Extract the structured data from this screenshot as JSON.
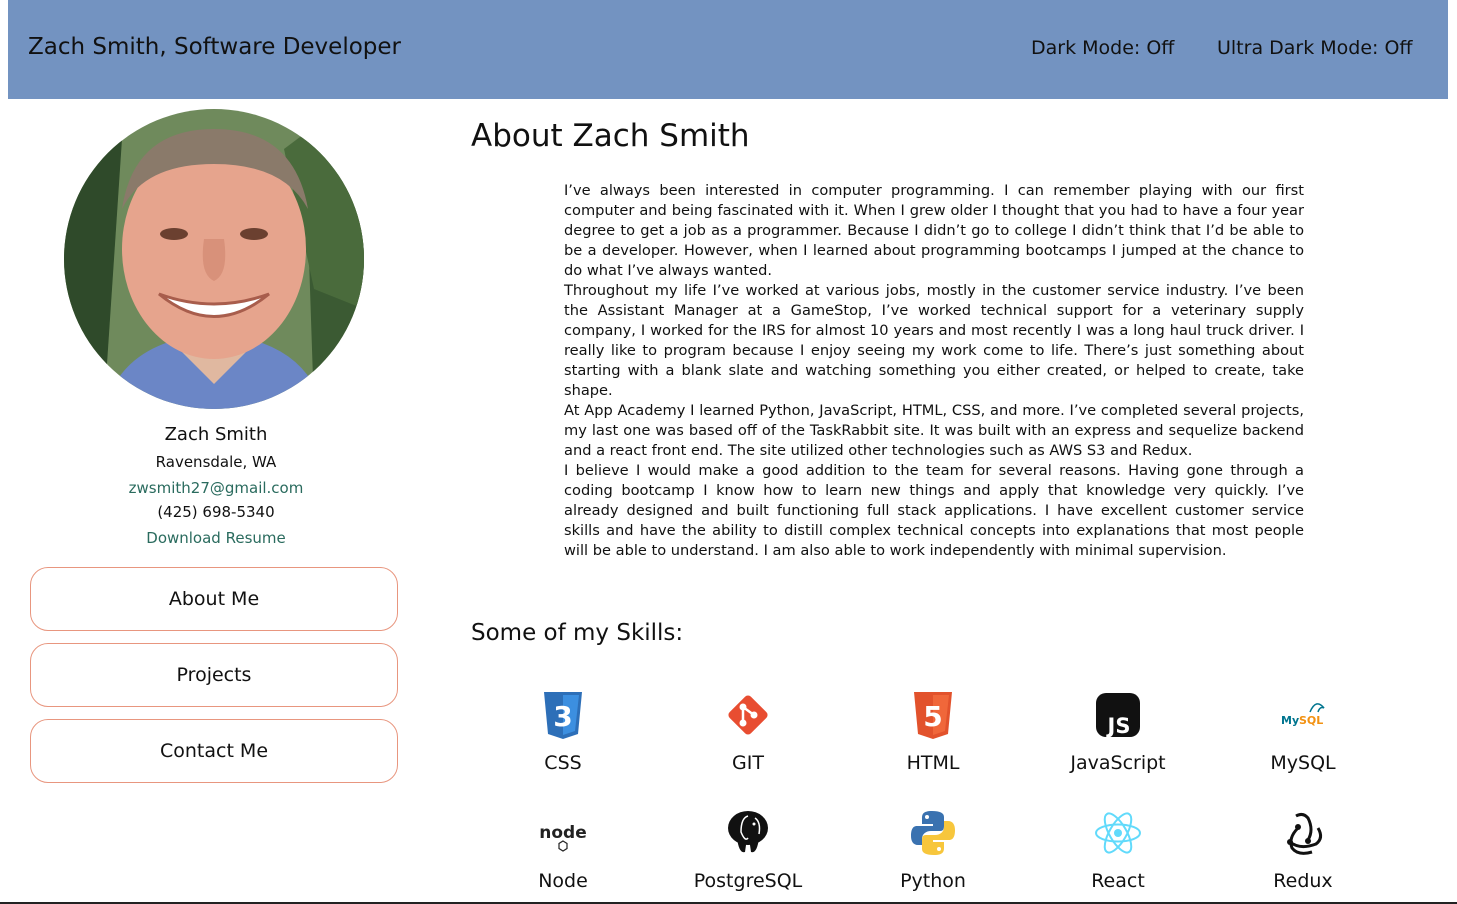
{
  "header": {
    "title": "Zach Smith, Software Developer",
    "dark_mode": "Dark Mode: Off",
    "ultra_dark_mode": "Ultra Dark Mode: Off",
    "background_color": "#7393c1"
  },
  "sidebar": {
    "name": "Zach Smith",
    "location": "Ravensdale, WA",
    "email": "zwsmith27@gmail.com",
    "phone": "(425) 698-5340",
    "resume": "Download Resume",
    "nav": [
      {
        "label": "About Me"
      },
      {
        "label": "Projects"
      },
      {
        "label": "Contact Me"
      }
    ],
    "link_color": "#2a6b5e",
    "button_border_color": "#e8967f"
  },
  "about": {
    "title": "About Zach Smith",
    "paragraphs": [
      "I’ve always been interested in computer programming. I can remember playing with our first computer and being fascinated with it. When I grew older I thought that you had to have a four year degree to get a job as a programmer. Because I didn’t go to college I didn’t think that I’d be able to be a developer. However, when I learned about programming bootcamps I jumped at the chance to do what I’ve always wanted.",
      "Throughout my life I’ve worked at various jobs, mostly in the customer service industry. I’ve been the Assistant Manager at a GameStop, I’ve worked technical support for a veterinary supply company, I worked for the IRS for almost 10 years and most recently I was a long haul truck driver. I really like to program because I enjoy seeing my work come to life. There’s just something about starting with a blank slate and watching something you either created, or helped to create, take shape.",
      "At App Academy I learned Python, JavaScript, HTML, CSS, and more. I’ve completed several projects, my last one was based off of the TaskRabbit site. It was built with an express and sequelize backend and a react front end. The site utilized other technologies such as AWS S3 and Redux.",
      "I believe I would make a good addition to the team for several reasons. Having gone through a coding bootcamp I know how to learn new things and apply that knowledge very quickly. I’ve already designed and built functioning full stack applications. I have excellent customer service skills and have the ability to distill complex technical concepts into explanations that most people will be able to understand. I am also able to work independently with minimal supervision."
    ]
  },
  "skills": {
    "title": "Some of my Skills:",
    "items": [
      {
        "label": "CSS",
        "icon": "css3-icon"
      },
      {
        "label": "GIT",
        "icon": "git-icon"
      },
      {
        "label": "HTML",
        "icon": "html5-icon"
      },
      {
        "label": "JavaScript",
        "icon": "javascript-icon"
      },
      {
        "label": "MySQL",
        "icon": "mysql-icon"
      },
      {
        "label": "Node",
        "icon": "node-icon"
      },
      {
        "label": "PostgreSQL",
        "icon": "postgresql-icon"
      },
      {
        "label": "Python",
        "icon": "python-icon"
      },
      {
        "label": "React",
        "icon": "react-icon"
      },
      {
        "label": "Redux",
        "icon": "redux-icon"
      }
    ]
  }
}
